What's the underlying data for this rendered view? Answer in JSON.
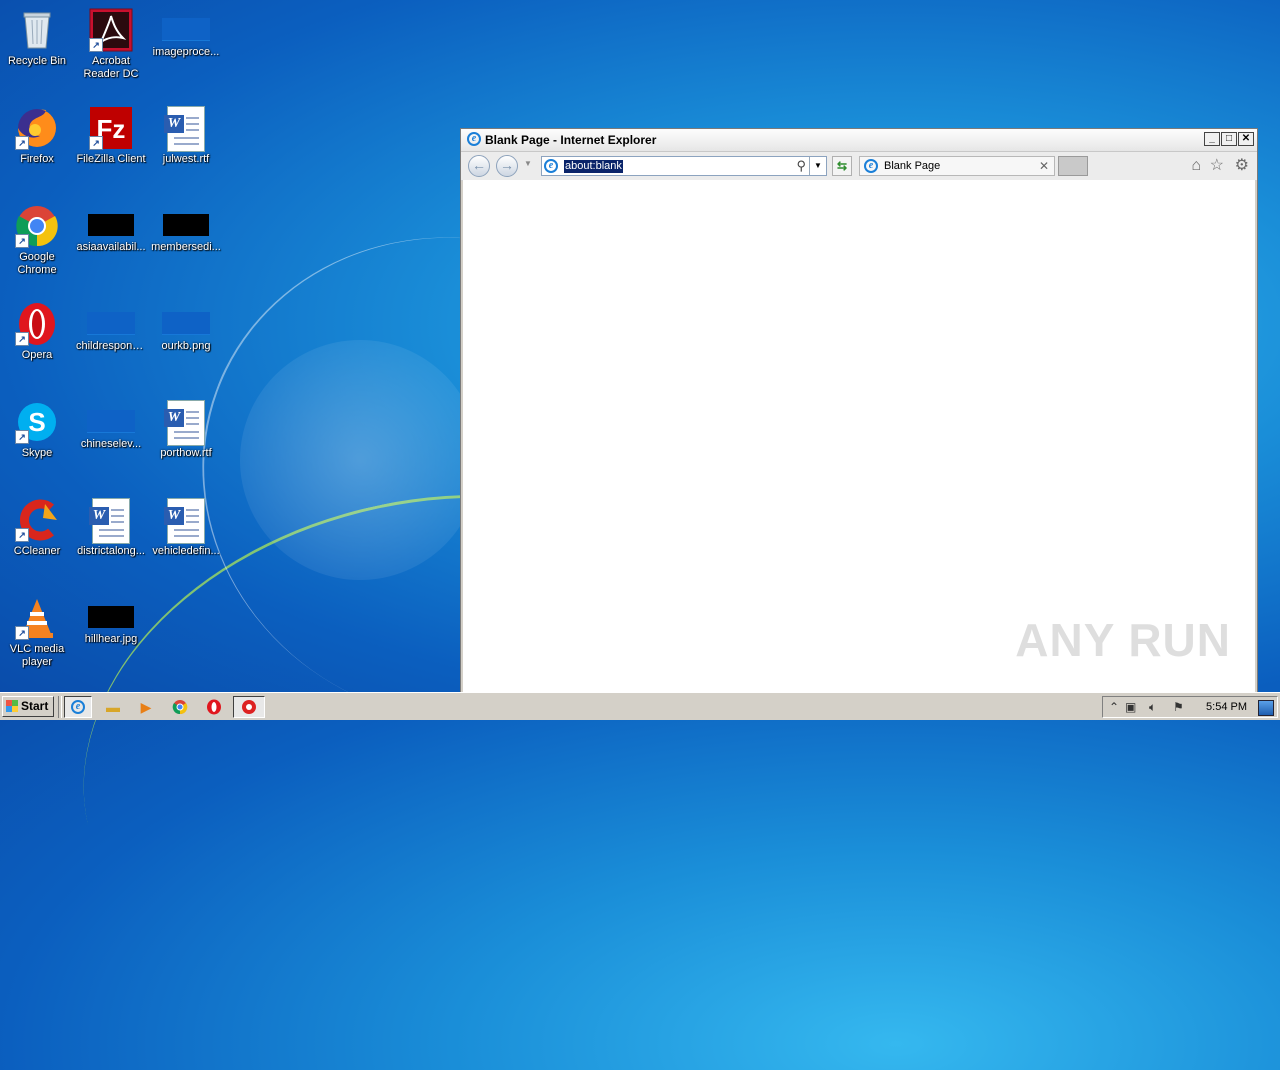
{
  "desktop": {
    "icons": [
      {
        "label": "Recycle Bin"
      },
      {
        "label": "Acrobat Reader DC"
      },
      {
        "label": "imageproce..."
      },
      {
        "label": "Firefox"
      },
      {
        "label": "FileZilla Client"
      },
      {
        "label": "julwest.rtf"
      },
      {
        "label": "Google Chrome"
      },
      {
        "label": "asiaavailabil..."
      },
      {
        "label": "membersedi..."
      },
      {
        "label": "Opera"
      },
      {
        "label": "childrespons..."
      },
      {
        "label": "ourkb.png"
      },
      {
        "label": "Skype"
      },
      {
        "label": "chineselev..."
      },
      {
        "label": "porthow.rtf"
      },
      {
        "label": "CCleaner"
      },
      {
        "label": "districtalong..."
      },
      {
        "label": "vehicledefin..."
      },
      {
        "label": "VLC media player"
      },
      {
        "label": "hillhear.jpg"
      }
    ]
  },
  "browser": {
    "title": "Blank Page - Internet Explorer",
    "address": "about:blank",
    "tab_label": "Blank Page",
    "watermark": "ANY RUN"
  },
  "taskbar": {
    "start_label": "Start",
    "clock": "5:54 PM"
  },
  "colors": {
    "desktop_bg": "#1a8ed8",
    "taskbar_bg": "#d4d0c8",
    "selection": "#0a246a"
  }
}
